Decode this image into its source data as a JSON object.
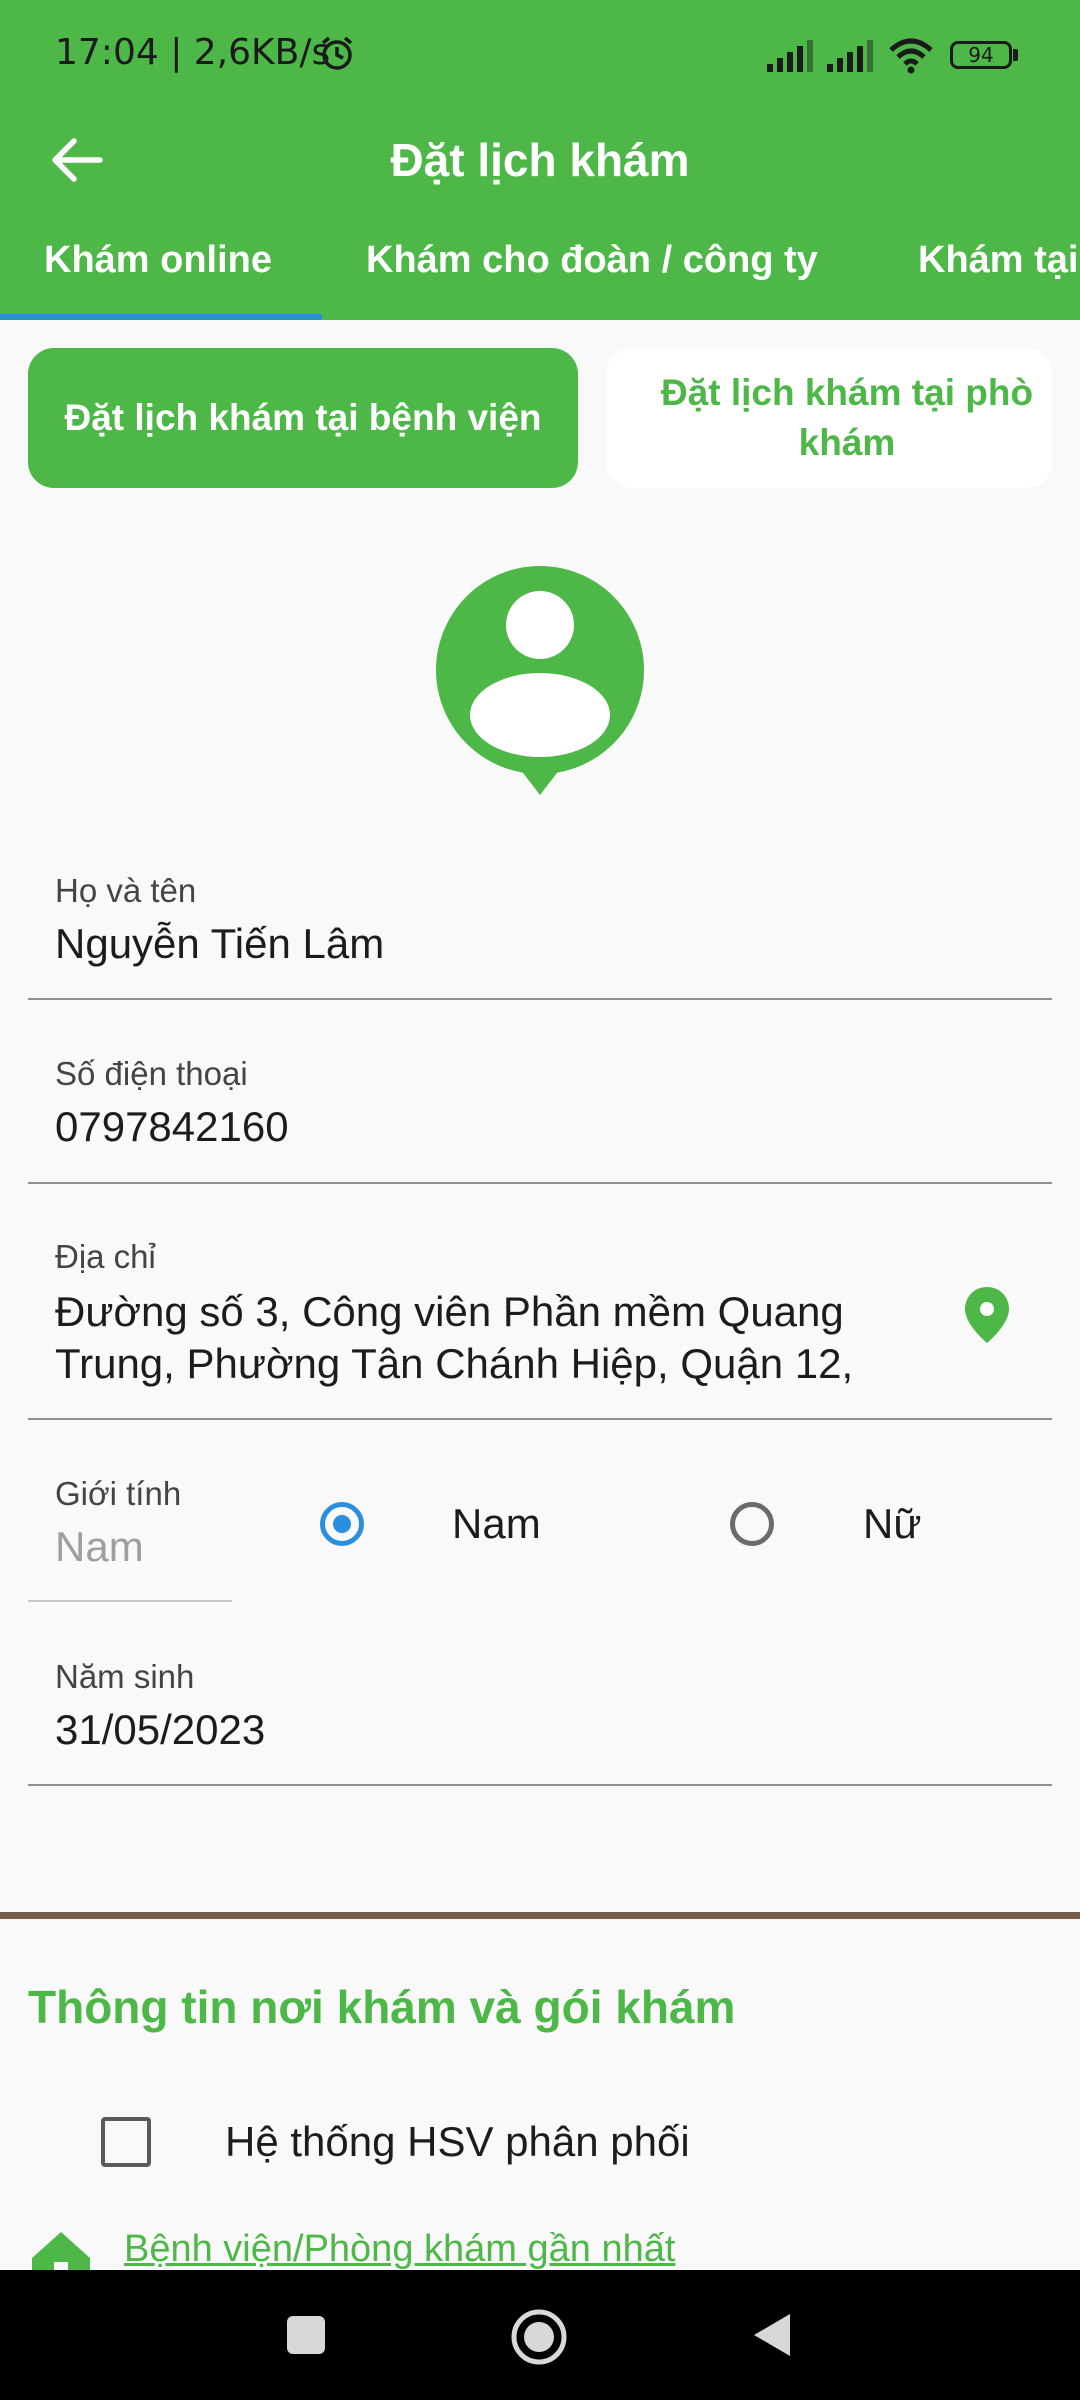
{
  "status": {
    "time": "17:04 | 2,6KB/s",
    "battery": "94"
  },
  "header": {
    "title": "Đặt lịch khám",
    "back_icon": "arrow-left-icon"
  },
  "tabs": [
    {
      "label": "Khám online",
      "active": true
    },
    {
      "label": "Khám cho đoàn / công ty",
      "active": false
    },
    {
      "label": "Khám tại",
      "active": false
    }
  ],
  "segments": [
    {
      "label": "Đặt lịch khám tại bệnh viện",
      "active": true
    },
    {
      "label": "Đặt lịch khám tại phò khám",
      "line1": "Đặt lịch khám tại phò",
      "line2": "khám",
      "active": false
    }
  ],
  "form": {
    "name": {
      "label": "Họ và tên",
      "value": "Nguyễn Tiến Lâm"
    },
    "phone": {
      "label": "Số điện thoại",
      "value": "0797842160"
    },
    "address": {
      "label": "Địa chỉ",
      "line1": "Đường số 3, Công viên Phần mềm Quang",
      "line2": "Trung, Phường Tân Chánh Hiệp, Quận 12,"
    },
    "gender": {
      "label": "Giới tính",
      "value": "Nam",
      "options": [
        "Nam",
        "Nữ"
      ],
      "selected": "Nam"
    },
    "birth": {
      "label": "Năm sinh",
      "value": "31/05/2023"
    }
  },
  "section": {
    "title": "Thông tin nơi khám và gói khám",
    "checkbox_label": "Hệ thống HSV phân phối",
    "nearest_link": "Bệnh viện/Phòng khám gần nhất"
  },
  "colors": {
    "primary": "#4db848",
    "indicator": "#2b8fe0",
    "divider": "#7a5a4a",
    "radio_selected": "#2b8fe0"
  }
}
